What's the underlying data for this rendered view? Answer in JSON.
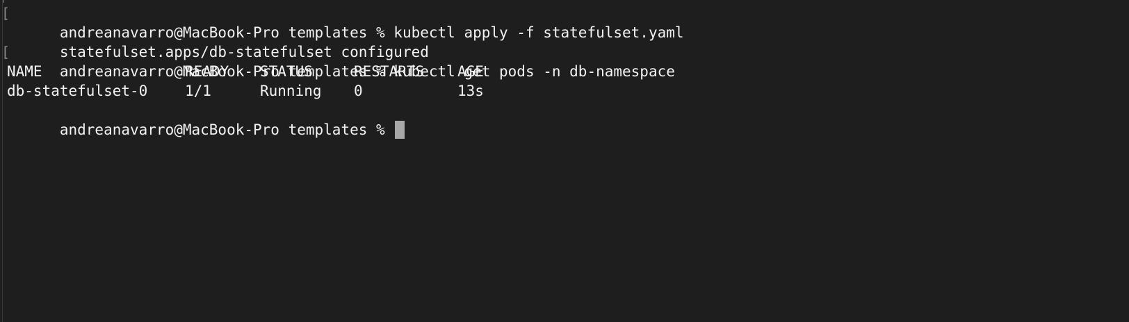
{
  "terminal": {
    "line1": {
      "prompt": "andreanavarro@MacBook-Pro templates % ",
      "command": "kubectl apply -f statefulset.yaml"
    },
    "line2": {
      "output": "statefulset.apps/db-statefulset configured"
    },
    "line3": {
      "prompt": "andreanavarro@MacBook-Pro templates % ",
      "command": "kubectl get pods -n db-namespace"
    },
    "pods_table": {
      "headers": [
        "NAME",
        "READY",
        "STATUS",
        "RESTARTS",
        "AGE"
      ],
      "rows": [
        [
          "db-statefulset-0",
          "1/1",
          "Running",
          "0",
          "13s"
        ]
      ]
    },
    "line6": {
      "prompt": "andreanavarro@MacBook-Pro templates % "
    },
    "colors": {
      "background": "#1e1e1e",
      "text": "#f2f2f2",
      "cursor": "#a8a8a8"
    }
  }
}
